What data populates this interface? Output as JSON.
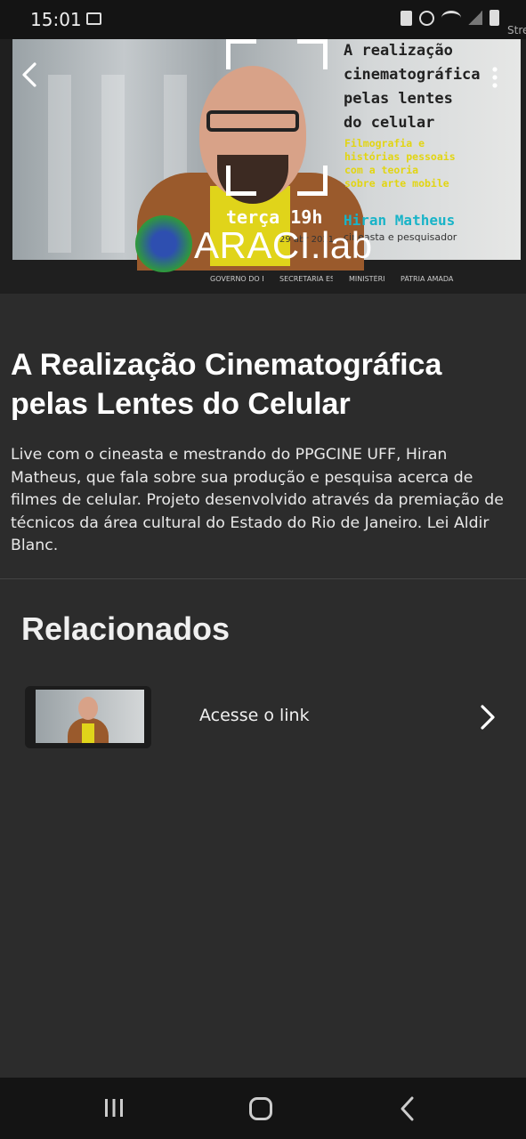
{
  "status_bar": {
    "time": "15:01",
    "icons": [
      "gallery-icon",
      "save-icon",
      "alarm-icon",
      "wifi-icon",
      "signal-icon",
      "battery-icon"
    ]
  },
  "hero": {
    "overflow_text": "Stre",
    "title_lines": [
      "A realização",
      "cinematográfica",
      "pelas lentes",
      "do celular"
    ],
    "subtitle_lines": [
      "Filmografia e",
      "histórias pessoais",
      "com a teoria",
      "sobre arte mobile"
    ],
    "day": "terça 19h",
    "date": "29 abr 2021",
    "guest_name": "Hiran Matheus",
    "guest_role": "cineasta e pesquisador",
    "logo_text": "ARACI.lab",
    "sponsors": [
      "GOVERNO DO ESTADO RIO DE JANEIRO",
      "SECRETARIA ESPECIAL DA CULTURA",
      "MINISTÉRIO DO TURISMO",
      "PÁTRIA AMADA BRASIL"
    ],
    "accent_yellow": "#e2d512",
    "accent_cyan": "#19b4c8"
  },
  "content": {
    "title": "A Realização Cinematográfica pelas Lentes do Celular",
    "description": "Live com o cineasta e mestrando do PPGCINE UFF, Hiran Matheus, que fala sobre sua produção e pesquisa acerca de filmes de celular. Projeto desenvolvido através da premiação de técnicos da área cultural do Estado do Rio de Janeiro. Lei Aldir Blanc."
  },
  "related": {
    "heading": "Relacionados",
    "items": [
      {
        "label": "Acesse o link",
        "icon": "chevron-right-icon"
      }
    ]
  },
  "nav_bar": {
    "icons": [
      "recent-apps-icon",
      "home-icon",
      "back-icon"
    ]
  }
}
